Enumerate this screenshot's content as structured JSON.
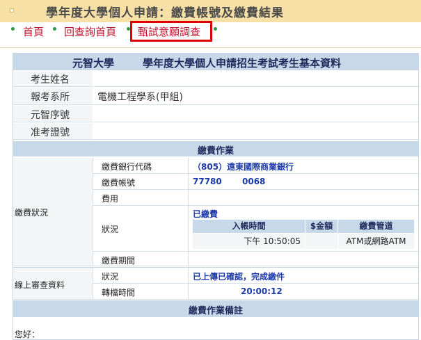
{
  "page": {
    "title": "學年度大學個人申請：繳費帳號及繳費結果"
  },
  "nav": {
    "items": [
      "首頁",
      "回查詢首頁",
      "甄試意願調查"
    ]
  },
  "basic": {
    "university": "元智大學",
    "heading": "學年度大學個人申請招生考試考生基本資料",
    "rows": [
      {
        "label": "考生姓名",
        "value": ""
      },
      {
        "label": "報考系所",
        "value": "電機工程學系(甲組)"
      },
      {
        "label": "元智序號",
        "value": ""
      },
      {
        "label": "准考證號",
        "value": ""
      }
    ]
  },
  "payment": {
    "section_title": "繳費作業",
    "group_label": "繳費狀況",
    "bank_code_label": "繳費銀行代碼",
    "bank_code_value": "（805）遠東國際商業銀行",
    "account_label": "繳費帳號",
    "account_part1": "77780",
    "account_part2": "0068",
    "fee_label": "費用",
    "fee_value": "",
    "status_label": "狀況",
    "status_value": "已繳費",
    "detail_headers": [
      "入帳時間",
      "$金額",
      "繳費管道"
    ],
    "detail_row": {
      "time": "下午 10:50:05",
      "amount": "",
      "channel": "ATM或網路ATM"
    },
    "period_label": "繳費期間",
    "period_value": ""
  },
  "online_review": {
    "group_label": "線上審查資料",
    "status_label": "狀況",
    "status_value": "已上傳已確認，完成繳件",
    "time_label": "轉檔時間",
    "time_value": "20:00:12"
  },
  "notes": {
    "section_title": "繳費作業備註",
    "greeting": "您好："
  }
}
